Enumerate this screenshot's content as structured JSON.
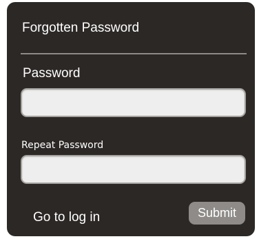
{
  "dialog": {
    "title": "Forgotten Password",
    "password_label": "Password",
    "password_value": "",
    "repeat_label": "Repeat Password",
    "repeat_value": "",
    "login_link": "Go to log in",
    "submit_label": "Submit"
  },
  "colors": {
    "dialog_background": "#2c2826",
    "field_background": "#eeeeee",
    "submit_background": "#8e8b88",
    "text": "#ffffff"
  }
}
